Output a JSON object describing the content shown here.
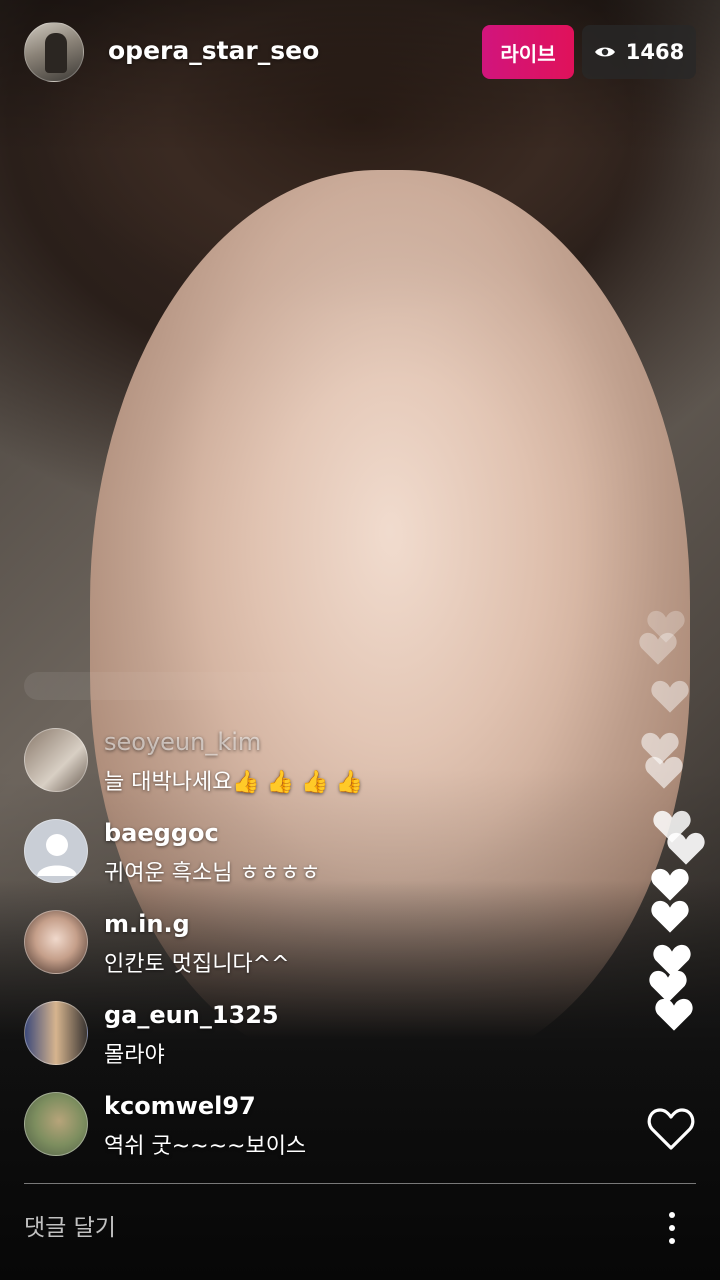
{
  "header": {
    "host_username": "opera_star_seo",
    "live_label": "라이브",
    "viewer_count": "1468",
    "viewer_icon": "eye-icon"
  },
  "comments": [
    {
      "username": "seoyeun_kim",
      "text": "늘 대박나세요👍  👍  👍  👍"
    },
    {
      "username": "baeggoc",
      "text": "귀여운 흑소님 ㅎㅎㅎㅎ"
    },
    {
      "username": "m.in.g",
      "text": "인칸토 멋집니다^^"
    },
    {
      "username": "ga_eun_1325",
      "text": "몰라야"
    },
    {
      "username": "kcomwel97",
      "text": "역쉬 굿~~~~보이스"
    }
  ],
  "footer": {
    "comment_placeholder": "댓글 달기",
    "more_icon": "more-vertical-icon",
    "like_icon": "heart-outline-icon"
  },
  "colors": {
    "live_badge": "#d1157d",
    "viewer_badge": "#282828"
  }
}
